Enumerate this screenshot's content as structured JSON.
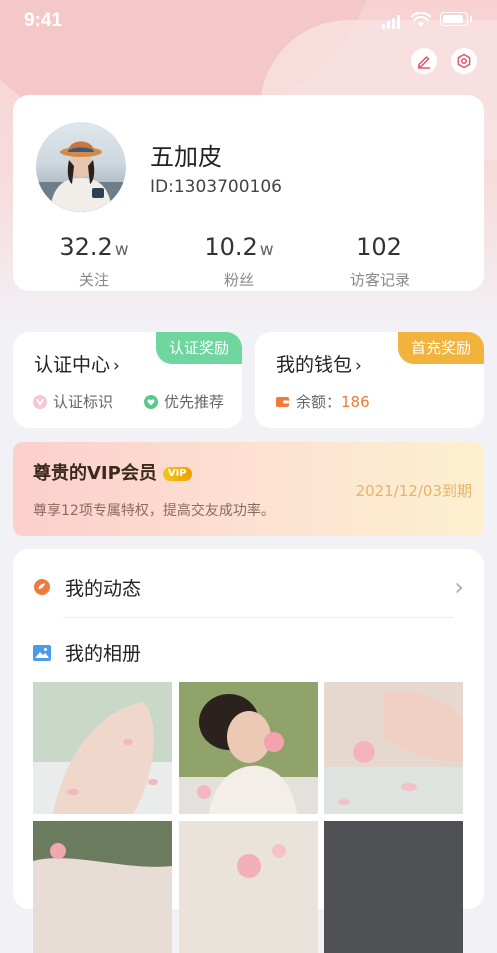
{
  "status_bar": {
    "time": "9:41"
  },
  "profile": {
    "name": "五加皮",
    "id_text": "ID:1303700106"
  },
  "stats": [
    {
      "value": "32.2",
      "unit": "w",
      "label": "关注"
    },
    {
      "value": "10.2",
      "unit": "w",
      "label": "粉丝"
    },
    {
      "value": "102",
      "unit": "",
      "label": "访客记录"
    }
  ],
  "certification": {
    "title": "认证中心",
    "chevron": "›",
    "badge": "认证奖励",
    "items": [
      "认证标识",
      "优先推荐"
    ]
  },
  "wallet": {
    "title": "我的钱包",
    "chevron": "›",
    "badge": "首充奖励",
    "balance_label": "余额：",
    "balance_value": "186"
  },
  "vip": {
    "title": "尊贵的VIP会员",
    "badge": "VIP",
    "desc": "尊享12项专属特权，提高交友成功率。",
    "expiry": "2021/12/03到期"
  },
  "menu": {
    "dynamics": "我的动态",
    "album": "我的相册",
    "chevron": "›"
  },
  "colors": {
    "green_badge": "#6fd6a0",
    "orange_badge": "#f2b33d",
    "balance": "#f07a3a",
    "vip_date": "#e5b46a"
  }
}
